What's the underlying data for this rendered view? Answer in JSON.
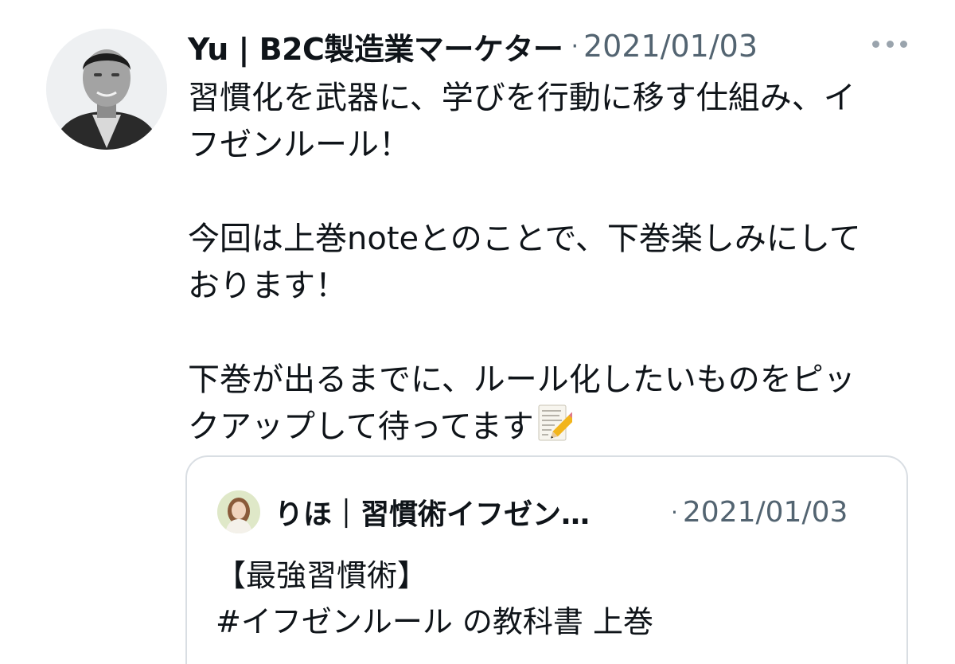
{
  "tweet": {
    "author_name": "Yu | B2C製造業マーケター",
    "separator": "·",
    "timestamp": "2021/01/03",
    "avatar_icon": "profile-photo",
    "more_icon": "more-horizontal-icon",
    "body_lines": [
      [
        "習慣化を武器に、学びを行動に移す仕組み、イ",
        "フゼンルール！"
      ],
      [
        "今回は上巻noteとのことで、下巻楽しみにして",
        "おります！"
      ],
      [
        "下巻が出るまでに、ルール化したいものをピッ",
        "クアップして待ってます"
      ]
    ],
    "emoji": "memo-emoji"
  },
  "quoted_tweet": {
    "author_name": "りほ｜習慣術イフゼン…",
    "separator": "·",
    "timestamp": "2021/01/03",
    "body_lines": [
      "【最強習慣術】",
      "#イフゼンルール の教科書 上巻"
    ]
  },
  "colors": {
    "text": "#0f1419",
    "secondary": "#536471",
    "border": "#d9dee3"
  }
}
